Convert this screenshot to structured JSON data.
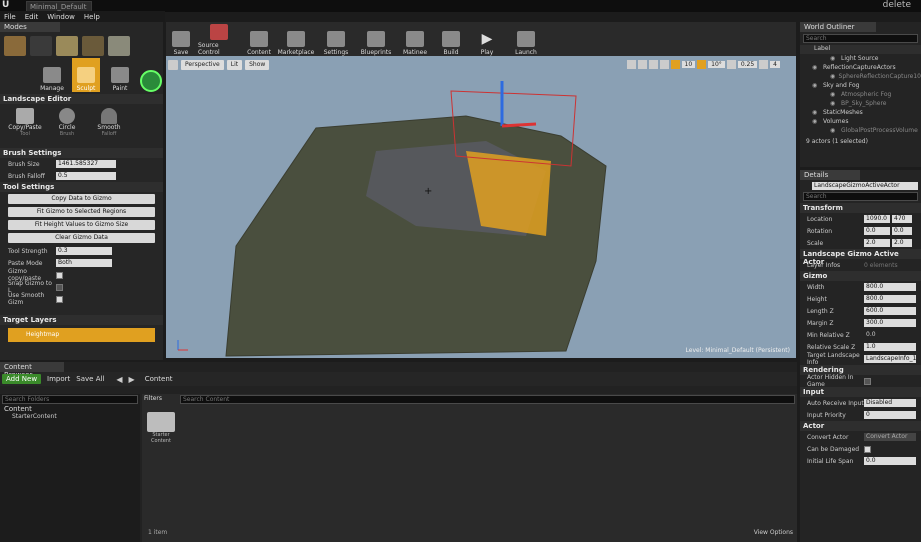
{
  "window": {
    "tab_title": "Minimal_Default",
    "close_label": "delete"
  },
  "menu": [
    "File",
    "Edit",
    "Window",
    "Help"
  ],
  "modes": {
    "header": "Modes",
    "tools": [
      "Manage",
      "Sculpt",
      "Paint"
    ]
  },
  "landscape_editor": {
    "header": "Landscape Editor",
    "tools": [
      {
        "label": "Copy/Paste",
        "sub": "Tool"
      },
      {
        "label": "Circle",
        "sub": "Brush"
      },
      {
        "label": "Smooth",
        "sub": "Falloff"
      }
    ]
  },
  "brush_settings": {
    "header": "Brush Settings",
    "brush_size_label": "Brush Size",
    "brush_size": "1461.585327",
    "brush_falloff_label": "Brush Falloff",
    "brush_falloff": "0.5"
  },
  "tool_settings": {
    "header": "Tool Settings",
    "buttons": [
      "Copy Data to Gizmo",
      "Fit Gizmo to Selected Regions",
      "Fit Height Values to Gizmo Size",
      "Clear Gizmo Data"
    ],
    "tool_strength_label": "Tool Strength",
    "tool_strength": "0.3",
    "paste_mode_label": "Paste Mode",
    "paste_mode": "Both",
    "gizmo_copy_label": "Gizmo copy/paste",
    "snap_gizmo_label": "Snap Gizmo to L",
    "use_smooth_label": "Use Smooth Gizm"
  },
  "target_layers": {
    "header": "Target Layers",
    "item": "Heightmap"
  },
  "toolbar": [
    "Save",
    "Source Control",
    "Content",
    "Marketplace",
    "Settings",
    "Blueprints",
    "Matinee",
    "Build",
    "Play",
    "Launch"
  ],
  "viewport": {
    "perspective": "Perspective",
    "lit": "Lit",
    "show": "Show",
    "grid_snap": "10",
    "rot_snap": "10°",
    "scale_snap": "0.25",
    "cam_speed": "4",
    "level_label": "Level: Minimal_Default (Persistent)"
  },
  "outliner": {
    "header": "World Outliner",
    "search_placeholder": "Search",
    "col_label": "Label",
    "items": [
      "Light Source",
      "ReflectionCaptureActors",
      "SphereReflectionCapture10",
      "Sky and Fog",
      "Atmospheric Fog",
      "BP_Sky_Sphere",
      "StaticMeshes",
      "Volumes",
      "GlobalPostProcessVolume"
    ],
    "status": "9 actors (1 selected)"
  },
  "details": {
    "header": "Details",
    "actor_name": "LandscapeGizmoActiveActor",
    "search_placeholder": "Search",
    "transform": {
      "header": "Transform",
      "location_label": "Location",
      "loc_x": "1090.0",
      "loc_y": "470",
      "rotation_label": "Rotation",
      "rot_x": "0.0",
      "rot_y": "0.0",
      "scale_label": "Scale",
      "scale_x": "2.0",
      "scale_y": "2.0"
    },
    "gizmo_actor": {
      "header": "Landscape Gizmo Active Actor",
      "layer_infos_label": "Layer Infos",
      "layer_infos_value": "0 elements"
    },
    "gizmo": {
      "header": "Gizmo",
      "rows": [
        {
          "label": "Width",
          "value": "800.0"
        },
        {
          "label": "Height",
          "value": "800.0"
        },
        {
          "label": "Length Z",
          "value": "600.0"
        },
        {
          "label": "Margin Z",
          "value": "300.0"
        },
        {
          "label": "Min Relative Z",
          "value": "0.0"
        },
        {
          "label": "Relative Scale Z",
          "value": "1.0"
        }
      ],
      "target_label": "Target Landscape Info",
      "target_value": "LandscapeInfo_1"
    },
    "rendering": {
      "header": "Rendering",
      "actor_hidden_label": "Actor Hidden In Game"
    },
    "input": {
      "header": "Input",
      "auto_receive_label": "Auto Receive Input",
      "auto_receive": "Disabled",
      "priority_label": "Input Priority",
      "priority": "0"
    },
    "actor": {
      "header": "Actor",
      "convert_label": "Convert Actor",
      "convert_value": "Convert Actor",
      "damaged_label": "Can be Damaged",
      "lifespan_label": "Initial Life Span",
      "lifespan": "0.0"
    }
  },
  "content_browser": {
    "header": "Content Browser",
    "add_new": "Add New",
    "import": "Import",
    "save_all": "Save All",
    "path": "Content",
    "search_folders": "Search Folders",
    "filters": "Filters",
    "search_content": "Search Content",
    "tree_root": "Content",
    "tree_child": "StarterContent",
    "asset_name": "Starter Content",
    "item_count": "1 item",
    "view_options": "View Options"
  }
}
